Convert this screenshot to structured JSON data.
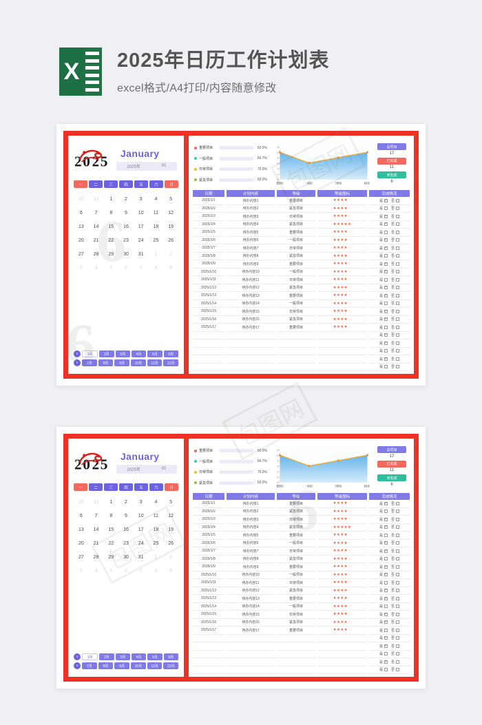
{
  "header": {
    "logo_letter": "X",
    "title": "2025年日历工作计划表",
    "subtitle": "excel格式/A4打印/内容随意修改"
  },
  "calendar": {
    "month_en": "January",
    "year_label": "2025年",
    "month_num": "01",
    "weekdays": [
      "一",
      "二",
      "三",
      "四",
      "五",
      "六",
      "日"
    ],
    "weekday_colors": [
      "#f4685e",
      "#6c63e0",
      "#6c63e0",
      "#6c63e0",
      "#6c63e0",
      "#6c63e0",
      "#f4685e"
    ],
    "days": [
      {
        "n": "30",
        "dim": true
      },
      {
        "n": "31",
        "dim": true
      },
      {
        "n": "1",
        "dim": false
      },
      {
        "n": "2",
        "dim": false
      },
      {
        "n": "3",
        "dim": false
      },
      {
        "n": "4",
        "dim": false
      },
      {
        "n": "5",
        "dim": false
      },
      {
        "n": "6",
        "dim": false
      },
      {
        "n": "7",
        "dim": false
      },
      {
        "n": "8",
        "dim": false
      },
      {
        "n": "9",
        "dim": false
      },
      {
        "n": "10",
        "dim": false
      },
      {
        "n": "11",
        "dim": false
      },
      {
        "n": "12",
        "dim": false
      },
      {
        "n": "13",
        "dim": false
      },
      {
        "n": "14",
        "dim": false
      },
      {
        "n": "15",
        "dim": false
      },
      {
        "n": "16",
        "dim": false
      },
      {
        "n": "17",
        "dim": false
      },
      {
        "n": "18",
        "dim": false
      },
      {
        "n": "19",
        "dim": false
      },
      {
        "n": "20",
        "dim": false
      },
      {
        "n": "21",
        "dim": false
      },
      {
        "n": "22",
        "dim": false
      },
      {
        "n": "23",
        "dim": false
      },
      {
        "n": "24",
        "dim": false
      },
      {
        "n": "25",
        "dim": false
      },
      {
        "n": "26",
        "dim": false
      },
      {
        "n": "27",
        "dim": false
      },
      {
        "n": "28",
        "dim": false
      },
      {
        "n": "29",
        "dim": false
      },
      {
        "n": "30",
        "dim": false
      },
      {
        "n": "31",
        "dim": false
      },
      {
        "n": "1",
        "dim": true
      },
      {
        "n": "2",
        "dim": true
      },
      {
        "n": "3",
        "dim": true
      },
      {
        "n": "4",
        "dim": true
      },
      {
        "n": "5",
        "dim": true
      },
      {
        "n": "6",
        "dim": true
      },
      {
        "n": "7",
        "dim": true
      },
      {
        "n": "8",
        "dim": true
      },
      {
        "n": "9",
        "dim": true
      }
    ],
    "months_row1": [
      "1月",
      "2月",
      "3月",
      "4月",
      "5月",
      "6月"
    ],
    "months_row2": [
      "7月",
      "8月",
      "9月",
      "10月",
      "11月",
      "12月"
    ],
    "active_month": "1月",
    "next_arrow": "»",
    "prev_arrow": "«"
  },
  "legend": [
    {
      "label": "重要项目",
      "pct": "60.0%",
      "value": 60.0,
      "color": "#f4685e"
    },
    {
      "label": "一般项目",
      "pct": "66.7%",
      "value": 66.7,
      "color": "#2ecfb0"
    },
    {
      "label": "日常项目",
      "pct": "75.0%",
      "value": 75.0,
      "color": "#f5b921"
    },
    {
      "label": "紧急项目",
      "pct": "60.0%",
      "value": 60.0,
      "color": "#8dc63f"
    }
  ],
  "stats": [
    {
      "label": "总项目",
      "value": "17",
      "color": "#8079e8"
    },
    {
      "label": "已完成",
      "value": "11",
      "color": "#f4685e"
    },
    {
      "label": "未完成",
      "value": "6",
      "color": "#2ebf9e"
    }
  ],
  "chart_data": {
    "type": "area",
    "title": "",
    "xlabel": "",
    "ylabel": "",
    "categories": [
      "重要项目",
      "一般项目",
      "日常项目",
      "紧急项目"
    ],
    "values": [
      5.0,
      3.0,
      4.0,
      5.0
    ],
    "ylim": [
      0.0,
      6.0
    ],
    "yticks": [
      "6.0",
      "5.0",
      "4.0",
      "3.0",
      "2.0",
      "1.0",
      "0.0"
    ],
    "line_color": "#f5a623",
    "marker_color": "#f5881f",
    "area_color_top": "#4aa8e8",
    "area_color_bottom": "#cfe8f8",
    "grid": false,
    "legend_position": "none"
  },
  "table": {
    "headers": [
      "日期",
      "计划内容",
      "等级",
      "等级图标",
      "完成情况"
    ],
    "done_yes": "是",
    "done_no": "否",
    "rows": [
      {
        "date": "2025/1/1",
        "task": "待办内容1",
        "level": "重要项目",
        "stars": 4,
        "yes": true,
        "no": false
      },
      {
        "date": "2025/1/2",
        "task": "待办内容2",
        "level": "紧急项目",
        "stars": 4,
        "yes": false,
        "no": false
      },
      {
        "date": "2025/1/3",
        "task": "待办内容3",
        "level": "日常项目",
        "stars": 4,
        "yes": true,
        "no": false
      },
      {
        "date": "2025/1/4",
        "task": "待办内容4",
        "level": "紧急项目",
        "stars": 5,
        "yes": true,
        "no": false
      },
      {
        "date": "2025/1/5",
        "task": "待办内容5",
        "level": "重要项目",
        "stars": 4,
        "yes": false,
        "no": false
      },
      {
        "date": "2025/1/6",
        "task": "待办内容6",
        "level": "一般项目",
        "stars": 4,
        "yes": true,
        "no": false
      },
      {
        "date": "2025/1/7",
        "task": "待办内容7",
        "level": "日常项目",
        "stars": 4,
        "yes": true,
        "no": false
      },
      {
        "date": "2025/1/8",
        "task": "待办内容8",
        "level": "紧急项目",
        "stars": 4,
        "yes": false,
        "no": false
      },
      {
        "date": "2025/1/9",
        "task": "待办内容9",
        "level": "重要项目",
        "stars": 4,
        "yes": true,
        "no": false
      },
      {
        "date": "2025/1/10",
        "task": "待办内容10",
        "level": "一般项目",
        "stars": 4,
        "yes": true,
        "no": false
      },
      {
        "date": "2025/1/11",
        "task": "待办内容11",
        "level": "日常项目",
        "stars": 4,
        "yes": false,
        "no": false
      },
      {
        "date": "2025/1/12",
        "task": "待办内容12",
        "level": "紧急项目",
        "stars": 4,
        "yes": true,
        "no": false
      },
      {
        "date": "2025/1/13",
        "task": "待办内容13",
        "level": "重要项目",
        "stars": 4,
        "yes": true,
        "no": false
      },
      {
        "date": "2025/1/14",
        "task": "待办内容14",
        "level": "一般项目",
        "stars": 4,
        "yes": false,
        "no": false
      },
      {
        "date": "2025/1/15",
        "task": "待办内容15",
        "level": "日常项目",
        "stars": 4,
        "yes": true,
        "no": false
      },
      {
        "date": "2025/1/16",
        "task": "待办内容16",
        "level": "紧急项目",
        "stars": 4,
        "yes": true,
        "no": false
      },
      {
        "date": "2025/1/17",
        "task": "待办内容17",
        "level": "重要项目",
        "stars": 4,
        "yes": false,
        "no": false
      },
      {
        "date": "",
        "task": "",
        "level": "",
        "stars": 0,
        "yes": true,
        "no": false
      },
      {
        "date": "",
        "task": "",
        "level": "",
        "stars": 0,
        "yes": true,
        "no": false
      },
      {
        "date": "",
        "task": "",
        "level": "",
        "stars": 0,
        "yes": false,
        "no": false
      },
      {
        "date": "",
        "task": "",
        "level": "",
        "stars": 0,
        "yes": true,
        "no": false
      },
      {
        "date": "",
        "task": "",
        "level": "",
        "stars": 0,
        "yes": false,
        "no": false
      }
    ]
  },
  "watermark": {
    "mark_a": "6",
    "mark_b": "包图网"
  }
}
